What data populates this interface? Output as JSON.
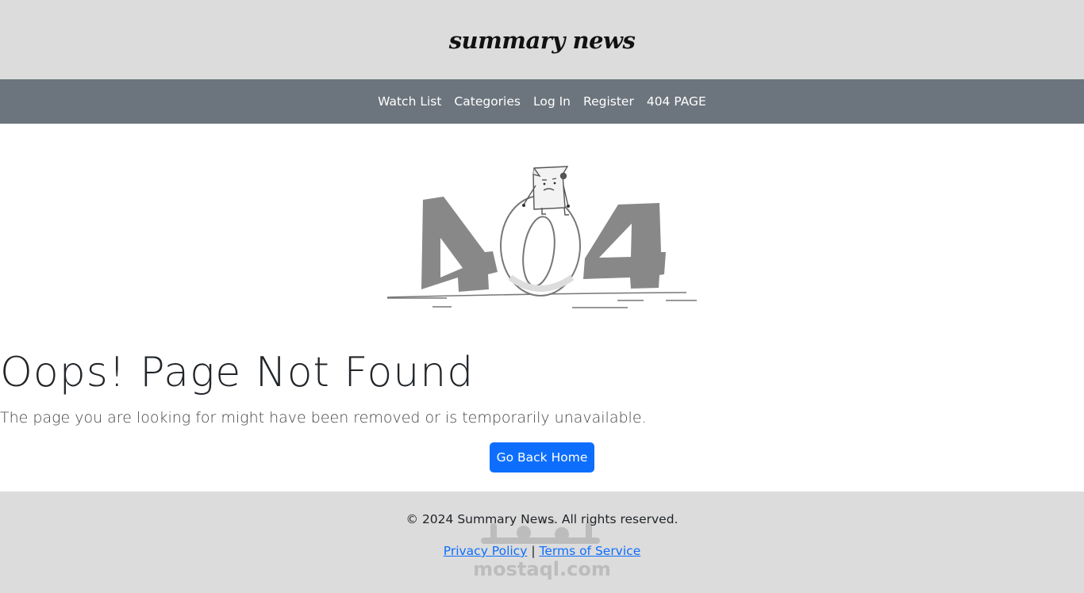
{
  "header": {
    "logo": "summary news"
  },
  "nav": {
    "items": [
      {
        "label": "Watch List"
      },
      {
        "label": "Categories"
      },
      {
        "label": "Log In"
      },
      {
        "label": "Register"
      },
      {
        "label": "404 PAGE"
      }
    ]
  },
  "main": {
    "title": "Oops! Page Not Found",
    "subtitle": "The page you are looking for might have been removed or is temporarily unavailable.",
    "button_label": "Go Back Home"
  },
  "footer": {
    "copyright": "© 2024 Summary News. All rights reserved.",
    "privacy_label": "Privacy Policy",
    "separator": "|",
    "terms_label": "Terms of Service"
  },
  "watermark": {
    "text": "mostaql.com"
  },
  "colors": {
    "header_bg": "#dcdcdc",
    "nav_bg": "#6c757d",
    "button_bg": "#0d6efd",
    "link": "#0d6efd"
  }
}
